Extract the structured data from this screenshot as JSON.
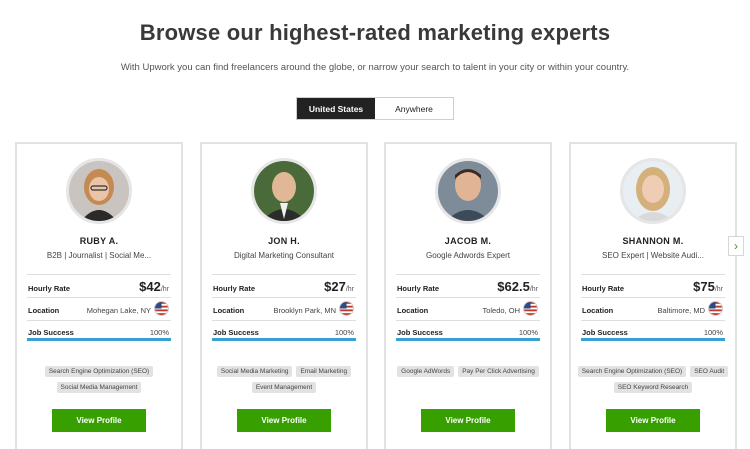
{
  "heading": "Browse our highest-rated marketing experts",
  "subheading": "With Upwork you can find freelancers around the globe, or narrow your search to talent in your city or within your country.",
  "toggle": {
    "options": [
      "United States",
      "Anywhere"
    ],
    "selected": "United States"
  },
  "labels": {
    "hourly_rate": "Hourly Rate",
    "location": "Location",
    "job_success": "Job Success",
    "rate_unit": "/hr",
    "view_profile": "View Profile"
  },
  "experts": [
    {
      "name": "RUBY A.",
      "title": "B2B | Journalist | Social Me...",
      "rate": "$42",
      "location": "Mohegan Lake, NY",
      "job_success": "100%",
      "job_success_fraction": 1.0,
      "skills": [
        "Search Engine Optimization (SEO)",
        "Social Media Management"
      ]
    },
    {
      "name": "JON H.",
      "title": "Digital Marketing Consultant",
      "rate": "$27",
      "location": "Brooklyn Park, MN",
      "job_success": "100%",
      "job_success_fraction": 1.0,
      "skills": [
        "Social Media Marketing",
        "Email Marketing",
        "Event Management"
      ]
    },
    {
      "name": "JACOB M.",
      "title": "Google Adwords Expert",
      "rate": "$62.5",
      "location": "Toledo, OH",
      "job_success": "100%",
      "job_success_fraction": 1.0,
      "skills": [
        "Google AdWords",
        "Pay Per Click Advertising"
      ]
    },
    {
      "name": "SHANNON M.",
      "title": "SEO Expert | Website Audi...",
      "rate": "$75",
      "location": "Baltimore, MD",
      "job_success": "100%",
      "job_success_fraction": 1.0,
      "skills": [
        "Search Engine Optimization (SEO)",
        "SEO Audit",
        "SEO Keyword Research"
      ]
    }
  ],
  "icons": {
    "flag": "us-flag-icon",
    "next": "chevron-right-icon"
  },
  "colors": {
    "accent": "#37a000",
    "progress": "#37a0d4",
    "toggle_active": "#222222"
  }
}
